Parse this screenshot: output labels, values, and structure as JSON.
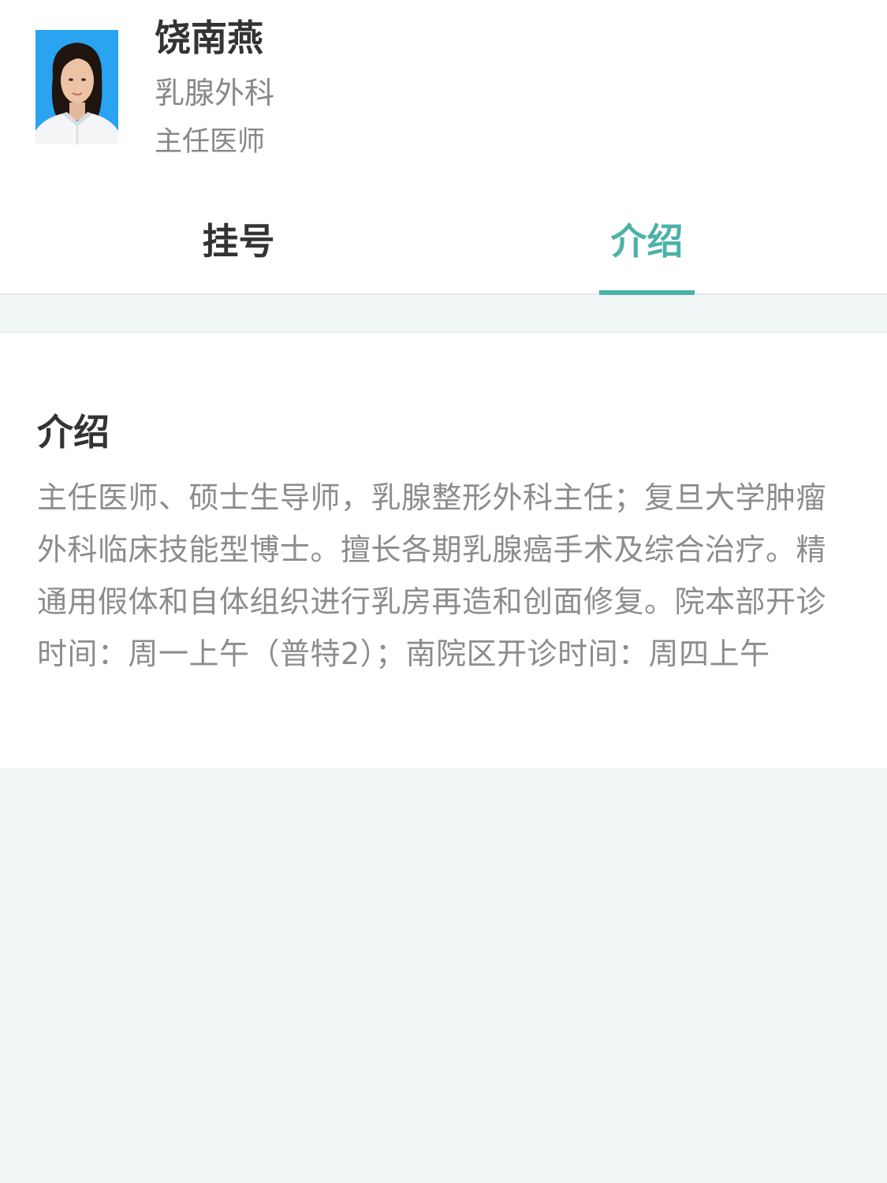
{
  "doctor": {
    "name": "饶南燕",
    "department": "乳腺外科",
    "title": "主任医师",
    "avatar_background": "#2aa3f0"
  },
  "tabs": [
    {
      "label": "挂号",
      "active": false
    },
    {
      "label": "介绍",
      "active": true
    }
  ],
  "accent_color": "#4bb2aa",
  "intro": {
    "heading": "介绍",
    "text": "主任医师、硕士生导师，乳腺整形外科主任；复旦大学肿瘤外科临床技能型博士。擅长各期乳腺癌手术及综合治疗。精通用假体和自体组织进行乳房再造和创面修复。院本部开诊时间：周一上午（普特2）；南院区开诊时间：周四上午"
  }
}
